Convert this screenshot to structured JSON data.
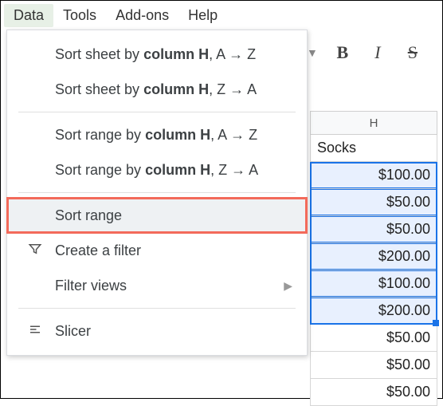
{
  "menubar": {
    "data": "Data",
    "tools": "Tools",
    "addons": "Add-ons",
    "help": "Help"
  },
  "dropdown": {
    "sort_sheet_az_pre": "Sort sheet by ",
    "sort_sheet_az_col": "column H",
    "sort_sheet_az_post": ", A → Z",
    "sort_sheet_za_pre": "Sort sheet by ",
    "sort_sheet_za_col": "column H",
    "sort_sheet_za_post": ", Z → A",
    "sort_range_az_pre": "Sort range by ",
    "sort_range_az_col": "column H",
    "sort_range_az_post": ", A → Z",
    "sort_range_za_pre": "Sort range by ",
    "sort_range_za_col": "column H",
    "sort_range_za_post": ", Z → A",
    "sort_range": "Sort range",
    "create_filter": "Create a filter",
    "filter_views": "Filter views",
    "slicer": "Slicer"
  },
  "toolbar": {
    "bold": "B",
    "italic": "I",
    "strike": "S"
  },
  "sheet": {
    "col_letter": "H",
    "header_cell": "Socks",
    "rows": {
      "r0": "$100.00",
      "r1": "$50.00",
      "r2": "$50.00",
      "r3": "$200.00",
      "r4": "$100.00",
      "r5": "$200.00",
      "r6": "$50.00",
      "r7": "$50.00",
      "r8": "$50.00"
    }
  }
}
